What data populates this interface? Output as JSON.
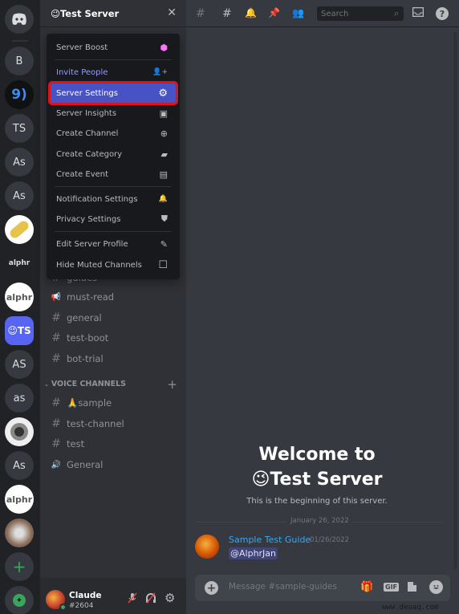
{
  "rail": {
    "servers": [
      {
        "label": "",
        "icon": "discord-home-icon"
      },
      {
        "label": "B"
      },
      {
        "label": "9)",
        "icon": "g-logo"
      },
      {
        "label": "TS"
      },
      {
        "label": "As"
      },
      {
        "label": "As"
      },
      {
        "label": "",
        "icon": "pill-image"
      },
      {
        "label": "alphr",
        "icon": "alphr-logo"
      },
      {
        "label": "alphr",
        "icon": "alphr-logo"
      },
      {
        "label": "😉TS",
        "active": true
      },
      {
        "label": "AS"
      },
      {
        "label": "as"
      },
      {
        "label": "",
        "icon": "ring-logo"
      },
      {
        "label": "As"
      },
      {
        "label": "alphr",
        "icon": "alphr-logo"
      },
      {
        "label": "",
        "icon": "photo-avatar"
      }
    ],
    "add_server": "+",
    "explore": "✦"
  },
  "sidebar": {
    "server_name": "😉Test Server",
    "close": "✕",
    "channels": [
      {
        "icon": "#",
        "name": "guides"
      },
      {
        "icon": "📢",
        "name": "must-read"
      },
      {
        "icon": "#",
        "name": "general"
      },
      {
        "icon": "#",
        "name": "test-boot"
      },
      {
        "icon": "#",
        "name": "bot-trial"
      }
    ],
    "voice_category": "VOICE CHANNELS",
    "voice_channels": [
      {
        "icon": "#",
        "name": "🙏sample"
      },
      {
        "icon": "#",
        "name": "test-channel"
      },
      {
        "icon": "#",
        "name": "test"
      },
      {
        "icon": "🔊",
        "name": "General"
      }
    ]
  },
  "user": {
    "name": "Claude",
    "tag": "#2604",
    "status_color": "#3ba55d"
  },
  "menu": {
    "items": [
      {
        "label": "Server Boost",
        "icon": "⬢"
      },
      {
        "label": "Invite People",
        "icon": "👤+"
      },
      {
        "label": "Server Settings",
        "icon": "⚙",
        "selected": true
      },
      {
        "label": "Server Insights",
        "icon": "▣"
      },
      {
        "label": "Create Channel",
        "icon": "⊕"
      },
      {
        "label": "Create Category",
        "icon": "▰"
      },
      {
        "label": "Create Event",
        "icon": "▤"
      },
      {
        "label": "Notification Settings",
        "icon": "🔔"
      },
      {
        "label": "Privacy Settings",
        "icon": "⛊"
      },
      {
        "label": "Edit Server Profile",
        "icon": "✎"
      },
      {
        "label": "Hide Muted Channels",
        "icon": "☐"
      }
    ]
  },
  "topbar": {
    "search_placeholder": "Search",
    "search_icon": "⌕",
    "help": "?"
  },
  "main": {
    "welcome_line1": "Welcome to",
    "welcome_line2": "😉Test Server",
    "welcome_sub": "This is the beginning of this server.",
    "date_divider": "January 26, 2022",
    "message": {
      "author": "Sample Test Guide",
      "timestamp": "01/26/2022",
      "content": "@AlphrJan"
    },
    "composer_placeholder": "Message #sample-guides",
    "gif": "GIF"
  },
  "watermark": "www.deuaq.com",
  "colors": {
    "accent": "#5865f2",
    "highlight_box": "#e0131a",
    "author": "#3aa7f0"
  }
}
